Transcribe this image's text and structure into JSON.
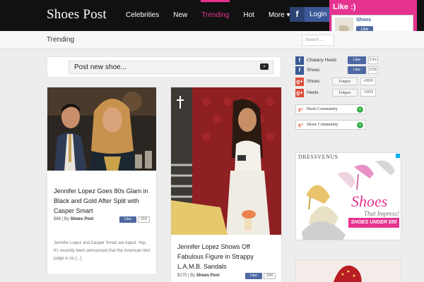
{
  "header": {
    "logo": "Shoes Post",
    "nav": [
      {
        "label": "Celebrities",
        "active": false
      },
      {
        "label": "New",
        "active": false
      },
      {
        "label": "Trending",
        "active": true
      },
      {
        "label": "Hot",
        "active": false
      },
      {
        "label": "More ▾",
        "active": false
      }
    ],
    "login_icon": "f",
    "login_label": "Login"
  },
  "like_popup": {
    "title": "Like :)",
    "page_name": "Shoes",
    "like_label": "Like",
    "close": "×"
  },
  "subheader": {
    "title": "Trending",
    "search_placeholder": "Search ..."
  },
  "composer": {
    "placeholder": "Post new shoe..."
  },
  "posts": [
    {
      "title": "Jennifer Lopez Goes 80s Glam in Black and Gold After Split with Casper Smart",
      "meta_prefix": "$88 | By",
      "author": "Shoes Post",
      "like_label": "Like",
      "like_count": "210",
      "excerpt": "Jennifer Lopez and Casper Smart are kaput. Yep, it's recently been announced that the American Idol judge is no [...]"
    },
    {
      "title": "Jennifer Lopez Shows Off Fabulous Figure in Strappy L.A.M.B. Sandals",
      "meta_prefix": "$175 | By",
      "author": "Shoes Post",
      "like_label": "Like",
      "like_count": "334"
    }
  ],
  "sidebar": {
    "social": [
      {
        "icon": "f",
        "type": "fb",
        "label": "Chalany Heels",
        "button": "Like",
        "count": "3.9m"
      },
      {
        "icon": "f",
        "type": "fb",
        "label": "Shoes",
        "button": "Like",
        "count": "520k"
      },
      {
        "icon": "g+",
        "type": "gp",
        "label": "Shoes",
        "button": "Folgen",
        "count": ">9999"
      },
      {
        "icon": "g+",
        "type": "gp",
        "label": "Heels",
        "button": "Folgen",
        "count": ">9999"
      }
    ],
    "communities": [
      {
        "icon": "g+",
        "label": "Heels Community",
        "action": "+"
      },
      {
        "icon": "g+",
        "label": "Shoes Community",
        "action": "+"
      }
    ],
    "ad": {
      "brand": "DRESSVENUS",
      "title": "Shoes",
      "subtitle": "That Impress!",
      "cta": "SHOES UNDER $50"
    }
  },
  "colors": {
    "accent": "#e5338f",
    "facebook": "#3b5998",
    "google": "#dd4b39",
    "topbar": "#111111"
  }
}
